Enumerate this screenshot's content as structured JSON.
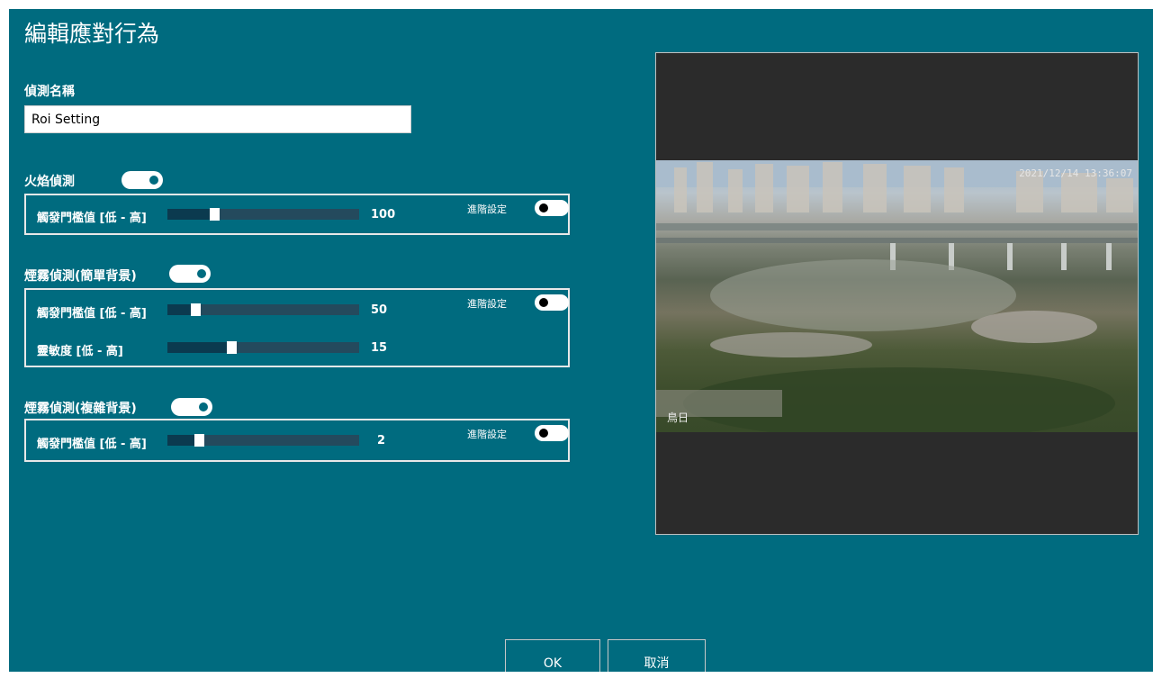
{
  "dialog": {
    "title": "編輯應對行為"
  },
  "name_field": {
    "label": "偵測名稱",
    "value": "Roi Setting"
  },
  "fire": {
    "label": "火焰偵測",
    "enabled": true,
    "threshold": {
      "label": "觸發門檻值 [低 - 高]",
      "value": "100",
      "fraction": 0.22
    },
    "advanced": {
      "label": "進階設定",
      "enabled": false
    }
  },
  "smoke_simple": {
    "label": "煙霧偵測(簡單背景)",
    "enabled": true,
    "threshold": {
      "label": "觸發門檻值 [低 - 高]",
      "value": "50",
      "fraction": 0.12
    },
    "sensitivity": {
      "label": "靈敏度 [低 - 高]",
      "value": "15",
      "fraction": 0.31
    },
    "advanced": {
      "label": "進階設定",
      "enabled": false
    }
  },
  "smoke_complex": {
    "label": "煙霧偵測(複雜背景)",
    "enabled": true,
    "threshold": {
      "label": "觸發門檻值 [低 - 高]",
      "value": "2",
      "fraction": 0.14
    },
    "advanced": {
      "label": "進階設定",
      "enabled": false
    }
  },
  "preview": {
    "timestamp": "2021/12/14 13:36:07",
    "camera_label": "鳥日"
  },
  "buttons": {
    "ok": "OK",
    "cancel": "取消"
  }
}
